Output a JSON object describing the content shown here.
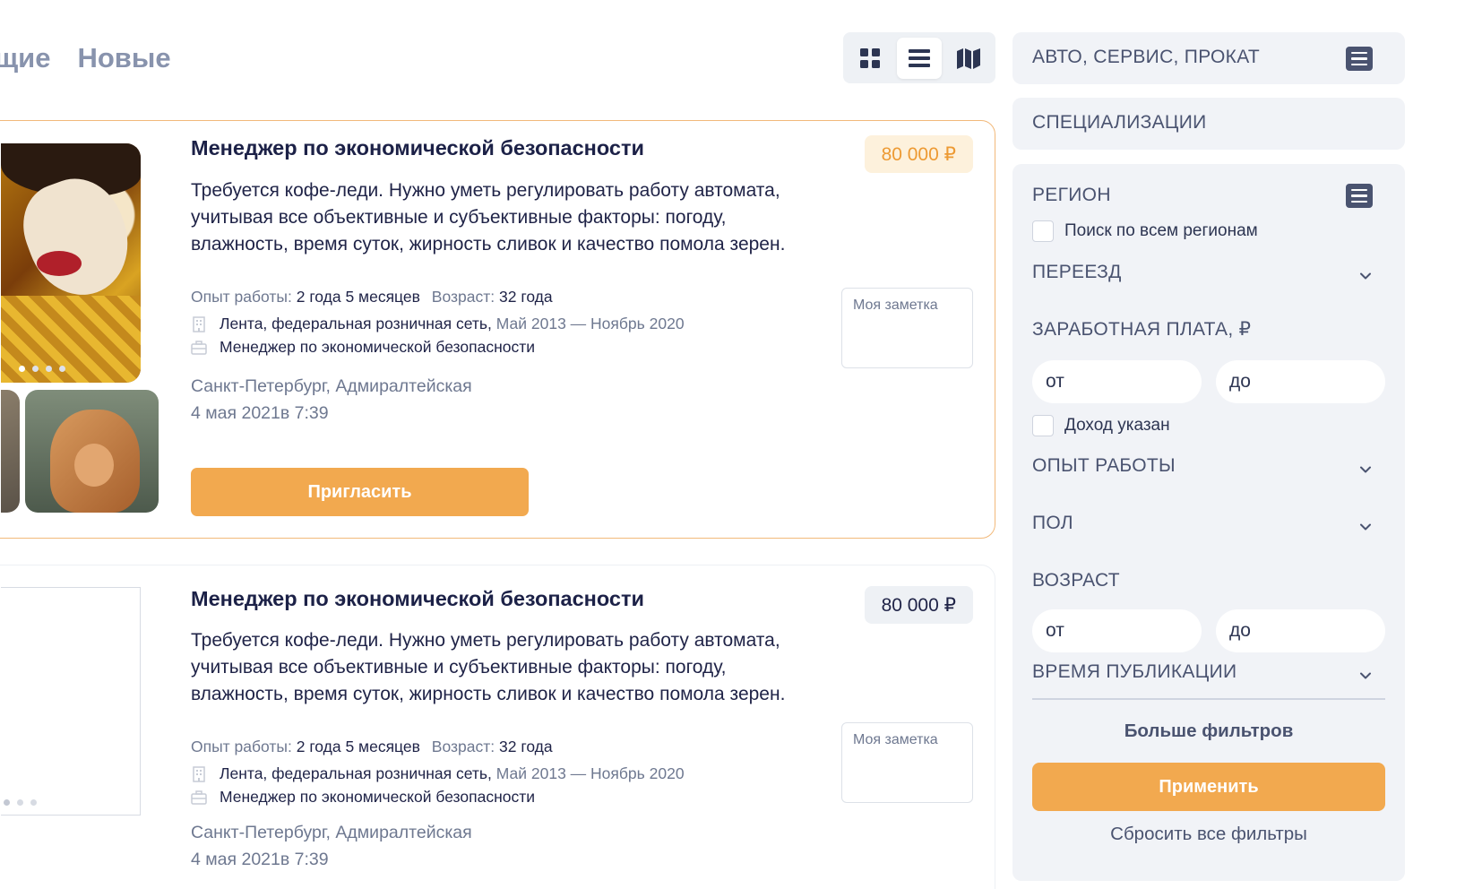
{
  "tabs": {
    "cut": "щие",
    "new": "Новые"
  },
  "view_switch": {
    "grid": "grid-icon",
    "list": "list-icon",
    "map": "map-icon",
    "active": "list"
  },
  "cards": [
    {
      "title": "Менеджер по экономической безопасности",
      "description": "Требуется кофе-леди. Нужно уметь регулировать работу автомата, учитывая все объективные и субъективные факторы: погоду, влажность, время суток, жирность сливок и качество помола зерен.",
      "experience_label": "Опыт работы:",
      "experience_value": "2 года 5 месяцев",
      "age_label": "Возраст:",
      "age_value": "32 года",
      "company": "Лента, федеральная розничная сеть,",
      "period": "Май 2013 — Ноябрь 2020",
      "position": "Менеджер по экономической безопасности",
      "location": "Санкт-Петербург, Адмиралтейская",
      "date": "4 мая 2021в 7:39",
      "price": "80 000 ₽",
      "note_placeholder": "Моя заметка",
      "invite_label": "Пригласить"
    },
    {
      "title": "Менеджер по экономической безопасности",
      "description": "Требуется кофе-леди. Нужно уметь регулировать работу автомата, учитывая все объективные и субъективные факторы: погоду, влажность, время суток, жирность сливок и качество помола зерен.",
      "experience_label": "Опыт работы:",
      "experience_value": "2 года 5 месяцев",
      "age_label": "Возраст:",
      "age_value": "32 года",
      "company": "Лента, федеральная розничная сеть,",
      "period": "Май 2013 — Ноябрь 2020",
      "position": "Менеджер по экономической безопасности",
      "location": "Санкт-Петербург, Адмиралтейская",
      "date": "4 мая 2021в 7:39",
      "price": "80 000 ₽",
      "note_placeholder": "Моя заметка"
    }
  ],
  "sidebar": {
    "category": "АВТО, СЕРВИС, ПРОКАТ",
    "specializations": "СПЕЦИАЛИЗАЦИИ",
    "region": "РЕГИОН",
    "search_all_regions": "Поиск по всем регионам",
    "relocation": "ПЕРЕЕЗД",
    "salary": "ЗАРАБОТНАЯ ПЛАТА, ₽",
    "salary_from": "от",
    "salary_to": "до",
    "income_specified": "Доход указан",
    "experience": "ОПЫТ РАБОТЫ",
    "gender": "ПОЛ",
    "age": "ВОЗРАСТ",
    "age_from": "от",
    "age_to": "до",
    "publication_time": "ВРЕМЯ ПУБЛИКАЦИИ",
    "more_filters": "Больше фильтров",
    "apply": "Применить",
    "reset": "Сбросить все фильтры"
  },
  "colors": {
    "accent": "#f2a94f",
    "price_orange": "#ed9a33",
    "sidebar_bg": "#f1f3f7",
    "text": "#1f2347",
    "muted": "#6e7890"
  }
}
